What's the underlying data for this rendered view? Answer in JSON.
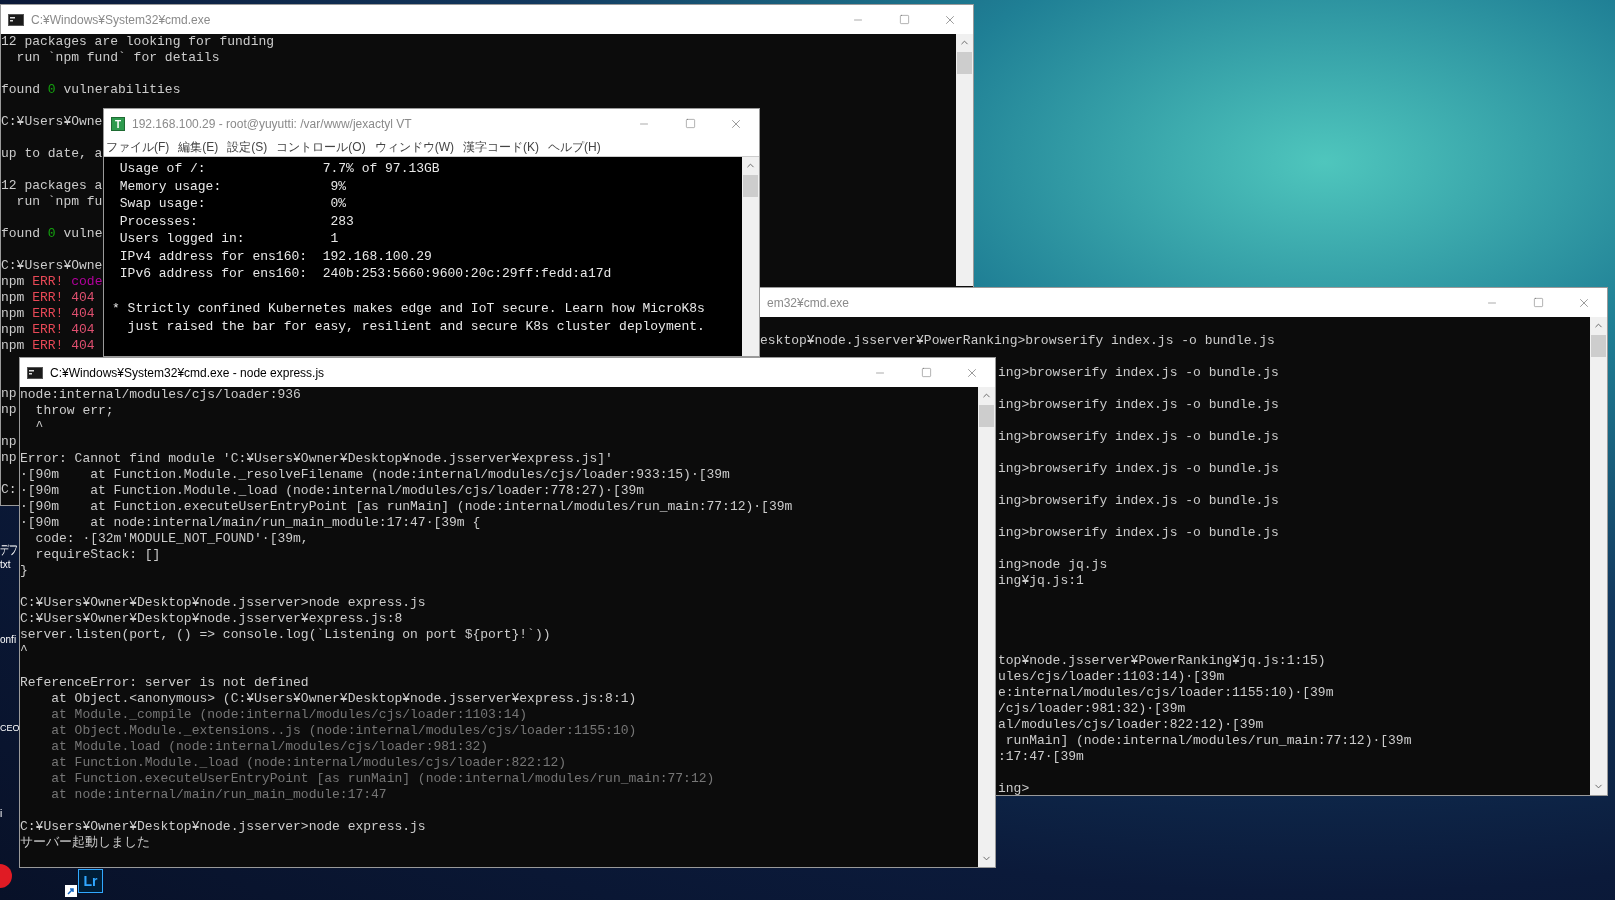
{
  "desktop": {
    "icon_labels": [
      {
        "text": "デフ"
      },
      {
        "text": "txt"
      },
      {
        "text": "onfi"
      },
      {
        "text": "CEO"
      },
      {
        "text": "i"
      }
    ],
    "shortcut": {
      "label": "Lr"
    }
  },
  "windows": [
    {
      "kind": "cmd",
      "title": "C:¥Windows¥System32¥cmd.exe",
      "active": false,
      "icon": true,
      "lines": [
        {
          "kind": "text",
          "text": "12 packages are looking for funding"
        },
        {
          "kind": "text",
          "text": "  run `npm fund` for details"
        },
        {
          "kind": "blank"
        },
        {
          "kind": "colored",
          "parts": [
            {
              "text": "found "
            },
            {
              "text": "0",
              "color": "#13a10e"
            },
            {
              "text": " vulnerabilities"
            }
          ]
        },
        {
          "kind": "blank"
        },
        {
          "kind": "text",
          "text": "C:¥Users¥Owne"
        },
        {
          "kind": "blank"
        },
        {
          "kind": "text",
          "text": "up to date, a"
        },
        {
          "kind": "blank"
        },
        {
          "kind": "text",
          "text": "12 packages a"
        },
        {
          "kind": "text",
          "text": "  run `npm fu"
        },
        {
          "kind": "blank"
        },
        {
          "kind": "colored",
          "parts": [
            {
              "text": "found "
            },
            {
              "text": "0",
              "color": "#13a10e"
            },
            {
              "text": " vulne"
            }
          ]
        },
        {
          "kind": "blank"
        },
        {
          "kind": "text",
          "text": "C:¥Users¥Owne"
        },
        {
          "kind": "colored",
          "parts": [
            {
              "text": "npm "
            },
            {
              "text": "ERR!",
              "color": "#e74856"
            },
            {
              "text": " code",
              "color": "#b4009e"
            }
          ]
        },
        {
          "kind": "colored",
          "parts": [
            {
              "text": "npm "
            },
            {
              "text": "ERR!",
              "color": "#e74856"
            },
            {
              "text": " 404",
              "color": "#e05070"
            }
          ]
        },
        {
          "kind": "colored",
          "parts": [
            {
              "text": "npm "
            },
            {
              "text": "ERR!",
              "color": "#e74856"
            },
            {
              "text": " 404",
              "color": "#e05070"
            }
          ]
        },
        {
          "kind": "colored",
          "parts": [
            {
              "text": "npm "
            },
            {
              "text": "ERR!",
              "color": "#e74856"
            },
            {
              "text": " 404",
              "color": "#e05070"
            }
          ]
        },
        {
          "kind": "colored",
          "parts": [
            {
              "text": "npm "
            },
            {
              "text": "ERR!",
              "color": "#e74856"
            },
            {
              "text": " 404",
              "color": "#e05070"
            }
          ]
        },
        {
          "kind": "blank"
        },
        {
          "kind": "blank"
        },
        {
          "kind": "text",
          "text": "np"
        },
        {
          "kind": "text",
          "text": "np"
        },
        {
          "kind": "blank"
        },
        {
          "kind": "text",
          "text": "np"
        },
        {
          "kind": "text",
          "text": "np"
        },
        {
          "kind": "blank"
        },
        {
          "kind": "text",
          "text": "C:"
        }
      ]
    },
    {
      "kind": "vt",
      "title": "192.168.100.29 - root@yuyutti: /var/www/jexactyl VT",
      "active": false,
      "icon": true,
      "icon_letter": "T",
      "menu": [
        "ファイル(F)",
        "編集(E)",
        "設定(S)",
        "コントロール(O)",
        "ウィンドウ(W)",
        "漢字コード(K)",
        "ヘルプ(H)"
      ],
      "lines": [
        {
          "kind": "text",
          "text": " Usage of /:               7.7% of 97.13GB"
        },
        {
          "kind": "text",
          "text": " Memory usage:              9%"
        },
        {
          "kind": "text",
          "text": " Swap usage:                0%"
        },
        {
          "kind": "text",
          "text": " Processes:                 283"
        },
        {
          "kind": "text",
          "text": " Users logged in:           1"
        },
        {
          "kind": "text",
          "text": " IPv4 address for ens160:  192.168.100.29"
        },
        {
          "kind": "text",
          "text": " IPv6 address for ens160:  240b:253:5660:9600:20c:29ff:fedd:a17d"
        },
        {
          "kind": "blank"
        },
        {
          "kind": "text",
          "text": "* Strictly confined Kubernetes makes edge and IoT secure. Learn how MicroK8s"
        },
        {
          "kind": "text",
          "text": "  just raised the bar for easy, resilient and secure K8s cluster deployment."
        }
      ]
    },
    {
      "kind": "cmd",
      "title": "em32¥cmd.exe",
      "active": false,
      "icon": false,
      "lines": [
        {
          "kind": "blank"
        },
        {
          "kind": "text",
          "text": "esktop¥node.jsserver¥PowerRanking>browserify index.js -o bundle.js"
        },
        {
          "kind": "blank"
        },
        {
          "kind": "clipped",
          "text": "ing>browserify index.js -o bundle.js"
        },
        {
          "kind": "blank"
        },
        {
          "kind": "clipped",
          "text": "ing>browserify index.js -o bundle.js"
        },
        {
          "kind": "blank"
        },
        {
          "kind": "clipped",
          "text": "ing>browserify index.js -o bundle.js"
        },
        {
          "kind": "blank"
        },
        {
          "kind": "clipped",
          "text": "ing>browserify index.js -o bundle.js"
        },
        {
          "kind": "blank"
        },
        {
          "kind": "clipped",
          "text": "ing>browserify index.js -o bundle.js"
        },
        {
          "kind": "blank"
        },
        {
          "kind": "clipped",
          "text": "ing>browserify index.js -o bundle.js"
        },
        {
          "kind": "blank"
        },
        {
          "kind": "clipped",
          "text": "ing>node jq.js"
        },
        {
          "kind": "clipped",
          "text": "ing¥jq.js:1"
        },
        {
          "kind": "blank"
        },
        {
          "kind": "blank"
        },
        {
          "kind": "blank"
        },
        {
          "kind": "blank"
        },
        {
          "kind": "clipped",
          "text": "top¥node.jsserver¥PowerRanking¥jq.js:1:15)"
        },
        {
          "kind": "clipped",
          "text": "ules/cjs/loader:1103:14)·[39m"
        },
        {
          "kind": "clipped",
          "text": "e:internal/modules/cjs/loader:1155:10)·[39m"
        },
        {
          "kind": "clipped",
          "text": "/cjs/loader:981:32)·[39m"
        },
        {
          "kind": "clipped",
          "text": "al/modules/cjs/loader:822:12)·[39m"
        },
        {
          "kind": "clipped",
          "text": " runMain] (node:internal/modules/run_main:77:12)·[39m"
        },
        {
          "kind": "clipped",
          "text": ":17:47·[39m"
        },
        {
          "kind": "blank"
        },
        {
          "kind": "clipped",
          "text": "ing>"
        }
      ]
    },
    {
      "kind": "cmd",
      "title": "C:¥Windows¥System32¥cmd.exe - node  express.js",
      "active": true,
      "icon": true,
      "lines": [
        {
          "kind": "text",
          "text": "node:internal/modules/cjs/loader:936"
        },
        {
          "kind": "text",
          "text": "  throw err;"
        },
        {
          "kind": "text",
          "text": "  ^"
        },
        {
          "kind": "blank"
        },
        {
          "kind": "text",
          "text": "Error: Cannot find module 'C:¥Users¥Owner¥Desktop¥node.jsserver¥express.js]'"
        },
        {
          "kind": "text",
          "text": "·[90m    at Function.Module._resolveFilename (node:internal/modules/cjs/loader:933:15)·[39m"
        },
        {
          "kind": "text",
          "text": "·[90m    at Function.Module._load (node:internal/modules/cjs/loader:778:27)·[39m"
        },
        {
          "kind": "text",
          "text": "·[90m    at Function.executeUserEntryPoint [as runMain] (node:internal/modules/run_main:77:12)·[39m"
        },
        {
          "kind": "text",
          "text": "·[90m    at node:internal/main/run_main_module:17:47·[39m {"
        },
        {
          "kind": "text",
          "text": "  code: ·[32m'MODULE_NOT_FOUND'·[39m,"
        },
        {
          "kind": "text",
          "text": "  requireStack: []"
        },
        {
          "kind": "text",
          "text": "}"
        },
        {
          "kind": "blank"
        },
        {
          "kind": "text",
          "text": "C:¥Users¥Owner¥Desktop¥node.jsserver>node express.js"
        },
        {
          "kind": "text",
          "text": "C:¥Users¥Owner¥Desktop¥node.jsserver¥express.js:8"
        },
        {
          "kind": "text",
          "text": "server.listen(port, () => console.log(`Listening on port ${port}!`))"
        },
        {
          "kind": "text",
          "text": "^"
        },
        {
          "kind": "blank"
        },
        {
          "kind": "text",
          "text": "ReferenceError: server is not defined"
        },
        {
          "kind": "text",
          "text": "    at Object.<anonymous> (C:¥Users¥Owner¥Desktop¥node.jsserver¥express.js:8:1)"
        },
        {
          "kind": "dim",
          "text": "    at Module._compile (node:internal/modules/cjs/loader:1103:14)"
        },
        {
          "kind": "dim",
          "text": "    at Object.Module._extensions..js (node:internal/modules/cjs/loader:1155:10)"
        },
        {
          "kind": "dim",
          "text": "    at Module.load (node:internal/modules/cjs/loader:981:32)"
        },
        {
          "kind": "dim",
          "text": "    at Function.Module._load (node:internal/modules/cjs/loader:822:12)"
        },
        {
          "kind": "dim",
          "text": "    at Function.executeUserEntryPoint [as runMain] (node:internal/modules/run_main:77:12)"
        },
        {
          "kind": "dim",
          "text": "    at node:internal/main/run_main_module:17:47"
        },
        {
          "kind": "blank"
        },
        {
          "kind": "text",
          "text": "C:¥Users¥Owner¥Desktop¥node.jsserver>node express.js"
        },
        {
          "kind": "text",
          "text": "サーバー起動しました"
        }
      ]
    }
  ]
}
